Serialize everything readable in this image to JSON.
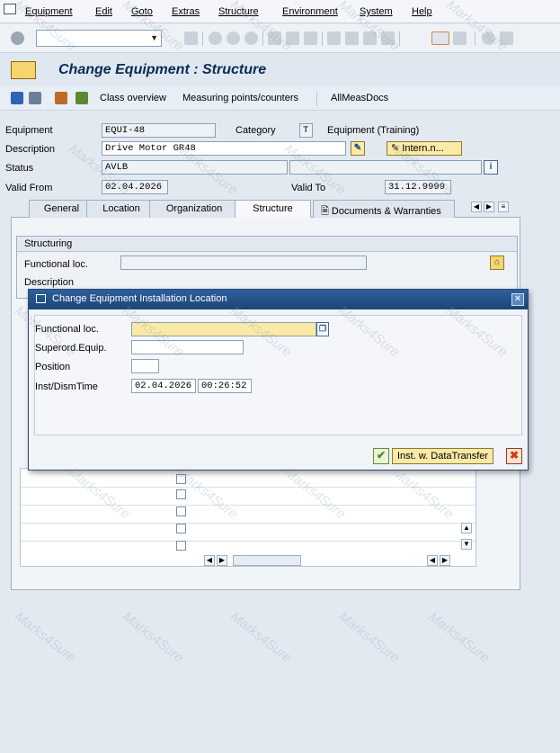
{
  "menu": {
    "items": [
      "Equipment",
      "Edit",
      "Goto",
      "Extras",
      "Structure",
      "Environment",
      "System",
      "Help"
    ]
  },
  "title": "Change Equipment : Structure",
  "app_toolbar": {
    "class_overview": "Class overview",
    "measuring_points": "Measuring points/counters",
    "all_meas_docs": "AllMeasDocs"
  },
  "header": {
    "equipment_label": "Equipment",
    "equipment_value": "EQUI-48",
    "category_label": "Category",
    "category_value": "T",
    "category_text": "Equipment (Training)",
    "description_label": "Description",
    "description_value": "Drive Motor GR48",
    "intern_button": "Intern.n...",
    "status_label": "Status",
    "status_value": "AVLB",
    "valid_from_label": "Valid From",
    "valid_from_value": "02.04.2026",
    "valid_to_label": "Valid To",
    "valid_to_value": "31.12.9999"
  },
  "tabs": [
    "General",
    "Location",
    "Organization",
    "Structure",
    "Documents & Warranties"
  ],
  "structuring": {
    "header": "Structuring",
    "functional_loc_label": "Functional loc.",
    "description_label": "Description"
  },
  "dialog": {
    "title": "Change Equipment Installation Location",
    "functional_loc_label": "Functional loc.",
    "functional_loc_value": "",
    "superord_label": "Superord.Equip.",
    "superord_value": "",
    "position_label": "Position",
    "position_value": "",
    "inst_label": "Inst/DismTime",
    "inst_date": "02.04.2026",
    "inst_time": "00:26:52",
    "transfer_button": "Inst. w. DataTransfer"
  },
  "watermark": "Marks4Sure",
  "colors": {
    "dialog_title_bg": "#1d4476",
    "required_field": "#fbe9a6",
    "background": "#e3e9f1"
  }
}
